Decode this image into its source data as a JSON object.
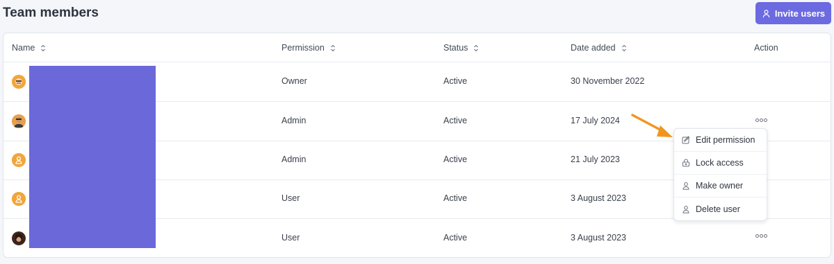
{
  "page": {
    "title": "Team members"
  },
  "header": {
    "invite_label": "Invite users",
    "invite_icon": "user-icon"
  },
  "table": {
    "columns": [
      {
        "label": "Name",
        "sortable": true
      },
      {
        "label": "Permission",
        "sortable": true
      },
      {
        "label": "Status",
        "sortable": true
      },
      {
        "label": "Date added",
        "sortable": true
      },
      {
        "label": "Action",
        "sortable": false
      }
    ],
    "rows": [
      {
        "avatar": "avatar-illustration",
        "permission": "Owner",
        "status": "Active",
        "date_added": "30 November 2022",
        "has_action": false
      },
      {
        "avatar": "avatar-photo",
        "permission": "Admin",
        "status": "Active",
        "date_added": "17 July 2024",
        "has_action": true
      },
      {
        "avatar": "avatar-placeholder",
        "permission": "Admin",
        "status": "Active",
        "date_added": "21 July 2023",
        "has_action": false
      },
      {
        "avatar": "avatar-placeholder",
        "permission": "User",
        "status": "Active",
        "date_added": "3 August 2023",
        "has_action": false
      },
      {
        "avatar": "avatar-photo",
        "permission": "User",
        "status": "Active",
        "date_added": "3 August 2023",
        "has_action": true
      }
    ]
  },
  "action_menu": {
    "items": [
      {
        "label": "Edit permission",
        "icon": "edit-icon"
      },
      {
        "label": "Lock access",
        "icon": "lock-icon"
      },
      {
        "label": "Make owner",
        "icon": "user-icon"
      },
      {
        "label": "Delete user",
        "icon": "user-icon"
      }
    ]
  },
  "colors": {
    "accent": "#6c6ae0",
    "redaction": "#6b68da",
    "annotation_arrow": "#f0961e",
    "avatar_orange": "#f1a53a"
  }
}
